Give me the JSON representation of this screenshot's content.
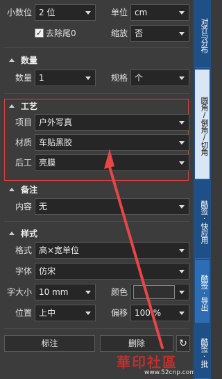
{
  "decimals": {
    "label": "小数位",
    "value": "2 位"
  },
  "unit": {
    "label": "单位",
    "value": "cm"
  },
  "remove_trailing_zero": {
    "label": "去除尾0",
    "checked": true
  },
  "scale": {
    "label": "缩放",
    "value": "否"
  },
  "quantity_section": {
    "title": "数量",
    "quantity": {
      "label": "数量",
      "value": "1"
    },
    "spec": {
      "label": "规格",
      "value": "个"
    }
  },
  "process_section": {
    "title": "工艺",
    "item": {
      "label": "项目",
      "value": "户外写真"
    },
    "material": {
      "label": "材质",
      "value": "车贴黑胶"
    },
    "post": {
      "label": "后工",
      "value": "亮膜"
    }
  },
  "note_section": {
    "title": "备注",
    "content": {
      "label": "内容",
      "value": "无"
    }
  },
  "style_section": {
    "title": "样式",
    "format": {
      "label": "格式",
      "value": "高×宽单位"
    },
    "font": {
      "label": "字体",
      "value": "仿宋"
    },
    "font_size": {
      "label": "字大小",
      "value": "10 mm"
    },
    "color": {
      "label": "颜色",
      "swatch": "#303030"
    },
    "position": {
      "label": "位置",
      "value": "上中"
    },
    "offset": {
      "label": "偏移",
      "value": "100 %"
    }
  },
  "actions": {
    "mark_label": "标注",
    "delete_label": "删除",
    "refresh_icon": "↻"
  },
  "sidebar_tabs": [
    {
      "label": "对齐与分布"
    },
    {
      "label": "圆角/倒角/切角"
    },
    {
      "label": "酷签·快应用"
    },
    {
      "label": "酷签·导出"
    },
    {
      "label": "酷签·批"
    }
  ],
  "watermark": {
    "text": "華印社區",
    "url": "www.52cnp.com"
  },
  "colors": {
    "highlight": "#e0403e",
    "arrow": "#e84646",
    "sidebar": "#1f4f87",
    "sidebar_active": "#2d6db3"
  }
}
